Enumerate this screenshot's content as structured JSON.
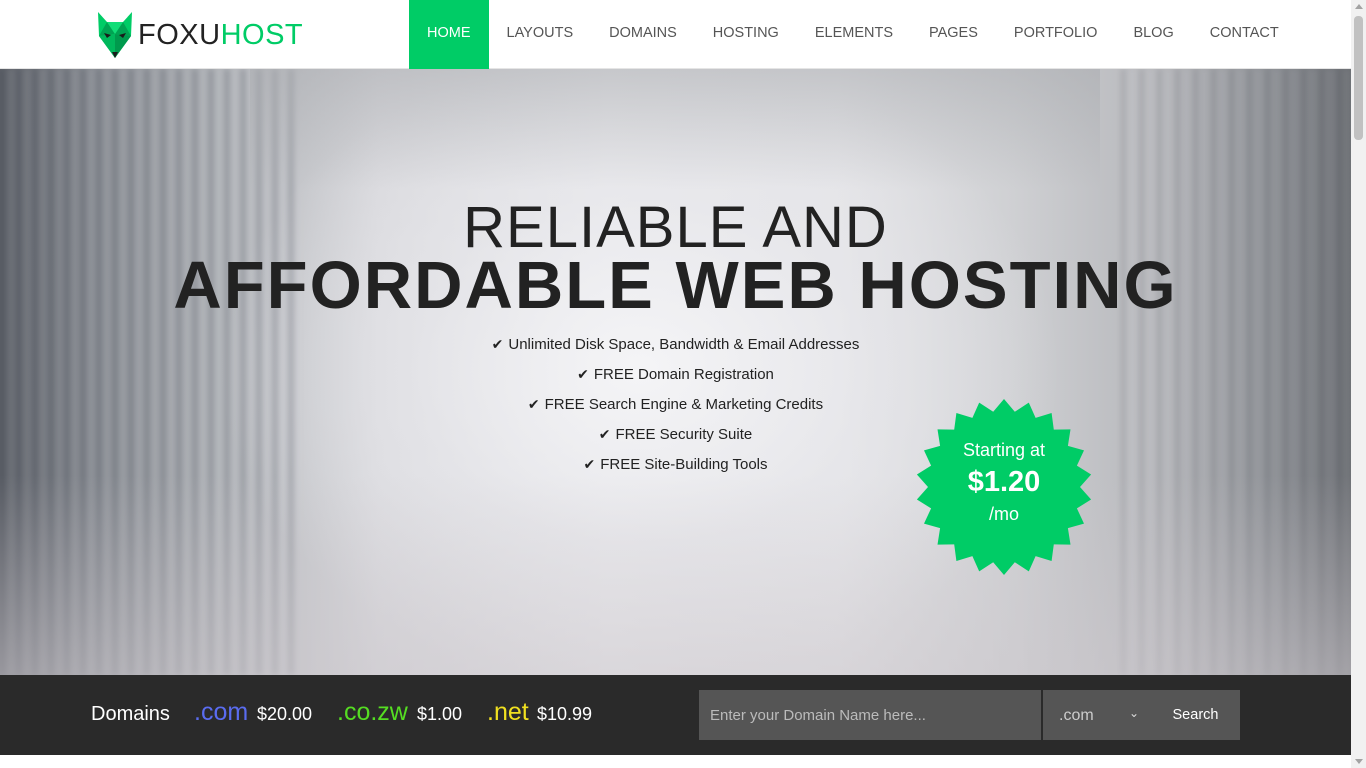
{
  "brand": {
    "name_part1": "FOXU",
    "name_part2": "HOST",
    "logo_icon": "fox-head-icon",
    "accent": "#00cc66"
  },
  "nav": [
    {
      "label": "HOME",
      "active": true
    },
    {
      "label": "LAYOUTS"
    },
    {
      "label": "DOMAINS"
    },
    {
      "label": "HOSTING"
    },
    {
      "label": "ELEMENTS"
    },
    {
      "label": "PAGES"
    },
    {
      "label": "PORTFOLIO"
    },
    {
      "label": "BLOG"
    },
    {
      "label": "CONTACT"
    }
  ],
  "hero": {
    "title_line1": "RELIABLE AND",
    "title_line2": "AFFORDABLE WEB HOSTING",
    "features": [
      "Unlimited Disk Space, Bandwidth & Email Addresses",
      "FREE Domain Registration",
      "FREE Search Engine & Marketing Credits",
      "FREE Security Suite",
      "FREE Site-Building Tools"
    ],
    "check_icon": "checkmark-icon",
    "badge": {
      "line1": "Starting at",
      "price": "$1.20",
      "period": "/mo"
    }
  },
  "domains": {
    "title": "Domains",
    "tlds": [
      {
        "ext": ".com",
        "price": "$20.00",
        "color": "#5a6cf0"
      },
      {
        "ext": ".co.zw",
        "price": "$1.00",
        "color": "#55dd22"
      },
      {
        "ext": ".net",
        "price": "$10.99",
        "color": "#f0e020"
      }
    ],
    "search_placeholder": "Enter your Domain Name here...",
    "select_value": ".com",
    "search_label": "Search"
  }
}
